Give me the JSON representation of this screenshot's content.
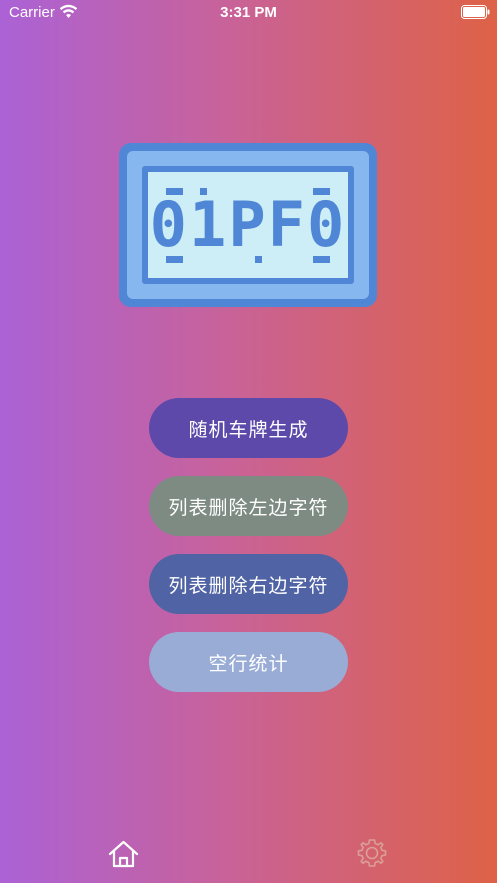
{
  "status_bar": {
    "carrier": "Carrier",
    "time": "3:31 PM",
    "icons": [
      "wifi-icon",
      "battery-icon"
    ]
  },
  "plate_logo": {
    "text": "01PF0",
    "icon": "license-plate-icon",
    "colors": {
      "frame": "#4f86d6",
      "border": "#86b8ef",
      "screen": "#cdeef6"
    }
  },
  "buttons": [
    {
      "label": "随机车牌生成",
      "color": "#5c49a9"
    },
    {
      "label": "列表删除左边字符",
      "color": "#7e8b83"
    },
    {
      "label": "列表删除右边字符",
      "color": "#4f63a5"
    },
    {
      "label": "空行统计",
      "color": "#98acd5"
    }
  ],
  "tab_bar": {
    "items": [
      {
        "icon": "home-icon",
        "selected": true
      },
      {
        "icon": "gear-icon",
        "selected": false
      }
    ]
  },
  "background_gradient": [
    "#ab62d6",
    "#de6247"
  ]
}
